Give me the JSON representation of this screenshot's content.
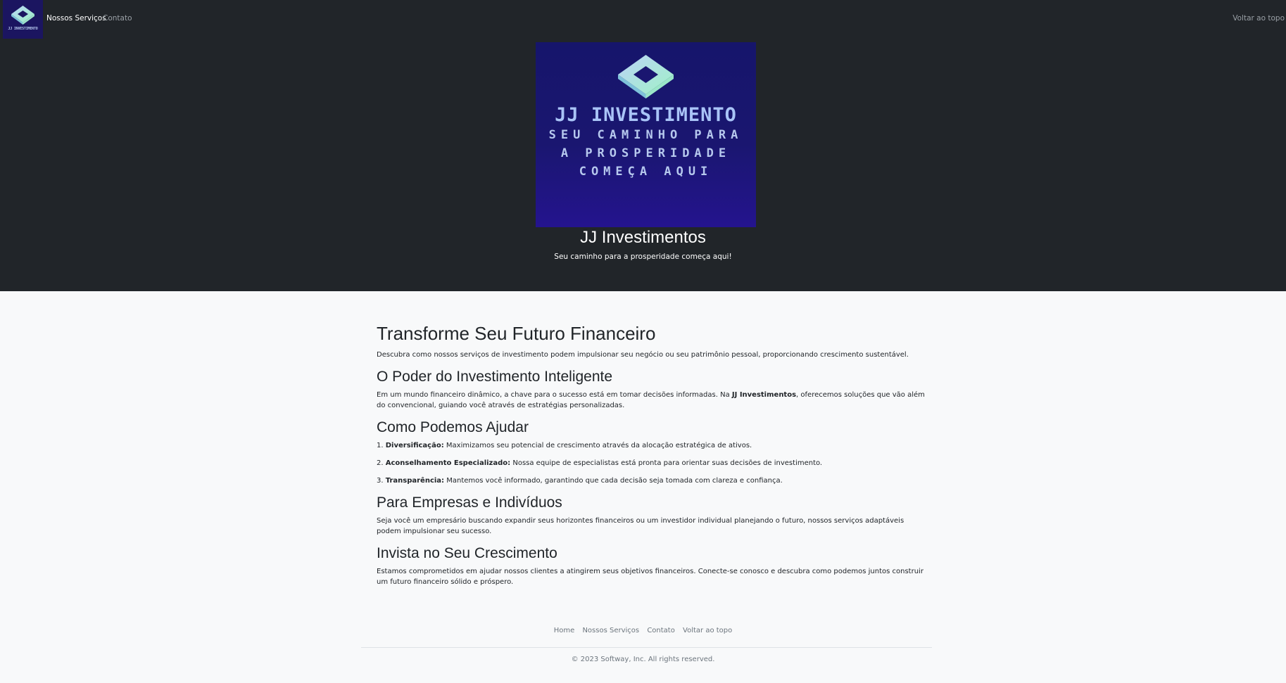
{
  "colors": {
    "header_bg": "#212529",
    "page_bg": "#f8f9fa",
    "brand_navy": "#1b1560",
    "muted_text": "#6c757d"
  },
  "navbar": {
    "logo_text": "JJ INVESTIMENTO",
    "items": [
      {
        "label": "Nossos Serviços"
      },
      {
        "label": "Contato"
      }
    ],
    "back_to_top": "Voltar ao topo"
  },
  "hero": {
    "image": {
      "name": "JJ INVESTIMENTO",
      "tagline_lines": [
        "SEU CAMINHO PARA",
        "A PROSPERIDADE",
        "COMEÇA AQUI"
      ]
    },
    "title": "JJ Investimentos",
    "subtitle": "Seu caminho para a prosperidade começa aqui!"
  },
  "main": {
    "heading": "Transforme Seu Futuro Financeiro",
    "intro": "Descubra como nossos serviços de investimento podem impulsionar seu negócio ou seu patrimônio pessoal, proporcionando crescimento sustentável.",
    "section1": {
      "heading": "O Poder do Investimento Inteligente",
      "text_before": "Em um mundo financeiro dinâmico, a chave para o sucesso está em tomar decisões informadas. Na ",
      "brand": "JJ Investimentos",
      "text_after": ", oferecemos soluções que vão além do convencional, guiando você através de estratégias personalizadas."
    },
    "section2": {
      "heading": "Como Podemos Ajudar",
      "items": [
        {
          "num": "1.",
          "title": "Diversificação:",
          "text": "Maximizamos seu potencial de crescimento através da alocação estratégica de ativos."
        },
        {
          "num": "2.",
          "title": "Aconselhamento Especializado:",
          "text": "Nossa equipe de especialistas está pronta para orientar suas decisões de investimento."
        },
        {
          "num": "3.",
          "title": "Transparência:",
          "text": "Mantemos você informado, garantindo que cada decisão seja tomada com clareza e confiança."
        }
      ]
    },
    "section3": {
      "heading": "Para Empresas e Indivíduos",
      "text": "Seja você um empresário buscando expandir seus horizontes financeiros ou um investidor individual planejando o futuro, nossos serviços adaptáveis podem impulsionar seu sucesso."
    },
    "section4": {
      "heading": "Invista no Seu Crescimento",
      "text": "Estamos comprometidos em ajudar nossos clientes a atingirem seus objetivos financeiros. Conecte-se conosco e descubra como podemos juntos construir um futuro financeiro sólido e próspero."
    }
  },
  "footer": {
    "links": [
      {
        "label": "Home"
      },
      {
        "label": "Nossos Serviços"
      },
      {
        "label": "Contato"
      },
      {
        "label": "Voltar ao topo"
      }
    ],
    "copyright": "© 2023 Softway, Inc. All rights reserved."
  }
}
